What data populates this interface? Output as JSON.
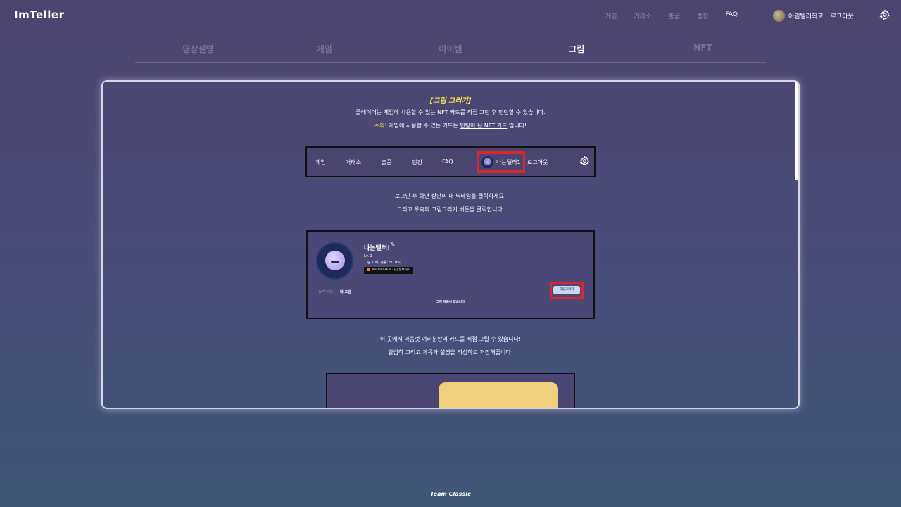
{
  "app": {
    "logo": "ImTeller"
  },
  "topnav": {
    "items": [
      "게임",
      "거래소",
      "출품",
      "랭킹",
      "FAQ"
    ],
    "active": "FAQ",
    "username": "아임텔러최고",
    "logout": "로그아웃"
  },
  "tabs": {
    "items": [
      "영상설명",
      "게임",
      "아이템",
      "그림",
      "NFT"
    ],
    "active": "그림"
  },
  "guide": {
    "title": "[그림 그리기]",
    "desc1": "플레이어는 게임에 사용할 수 있는 NFT 카드를 직접 그린 후 민팅할 수 있습니다.",
    "warn_label": "주의!",
    "desc2_a": " 게임에 사용할 수 있는 카드는 ",
    "desc2_ul": "민팅이 된 NFT 카드",
    "desc2_b": " 입니다!",
    "navshot": {
      "items": [
        "게임",
        "거래소",
        "출품",
        "랭킹",
        "FAQ"
      ],
      "username": "나는텔러1",
      "logout": "로그아웃"
    },
    "msg1": "로그인 후 화면 상단의 내 닉네임을 클릭하세요!",
    "msg2": "그리고 우측의 그림그리기 버튼을 클릭합니다.",
    "profile": {
      "name": "나는텔러!",
      "edit": "✎",
      "level": "Lv. 1",
      "record": "1 승 1 패, 승률: 50.0%",
      "metamask": "Metamask로 지갑 등록하기",
      "tab_nft": "NFT 카드",
      "tab_mine": "내 그림",
      "draw_button": "그림그리기",
      "empty": "그린 작품이 없습니다"
    },
    "msg3": "이 곳에서 마음껏 여러분만의 카드를 직접 그릴 수 있습니다!",
    "msg4": "열심히 그리고 제목과 설명을 작성하고 저장해줍니다!"
  },
  "footer": "Team Classic",
  "colors": {
    "accent_yellow": "#ffe84d",
    "highlight_red": "#d8262b",
    "card_yellow": "#f0d07e"
  }
}
